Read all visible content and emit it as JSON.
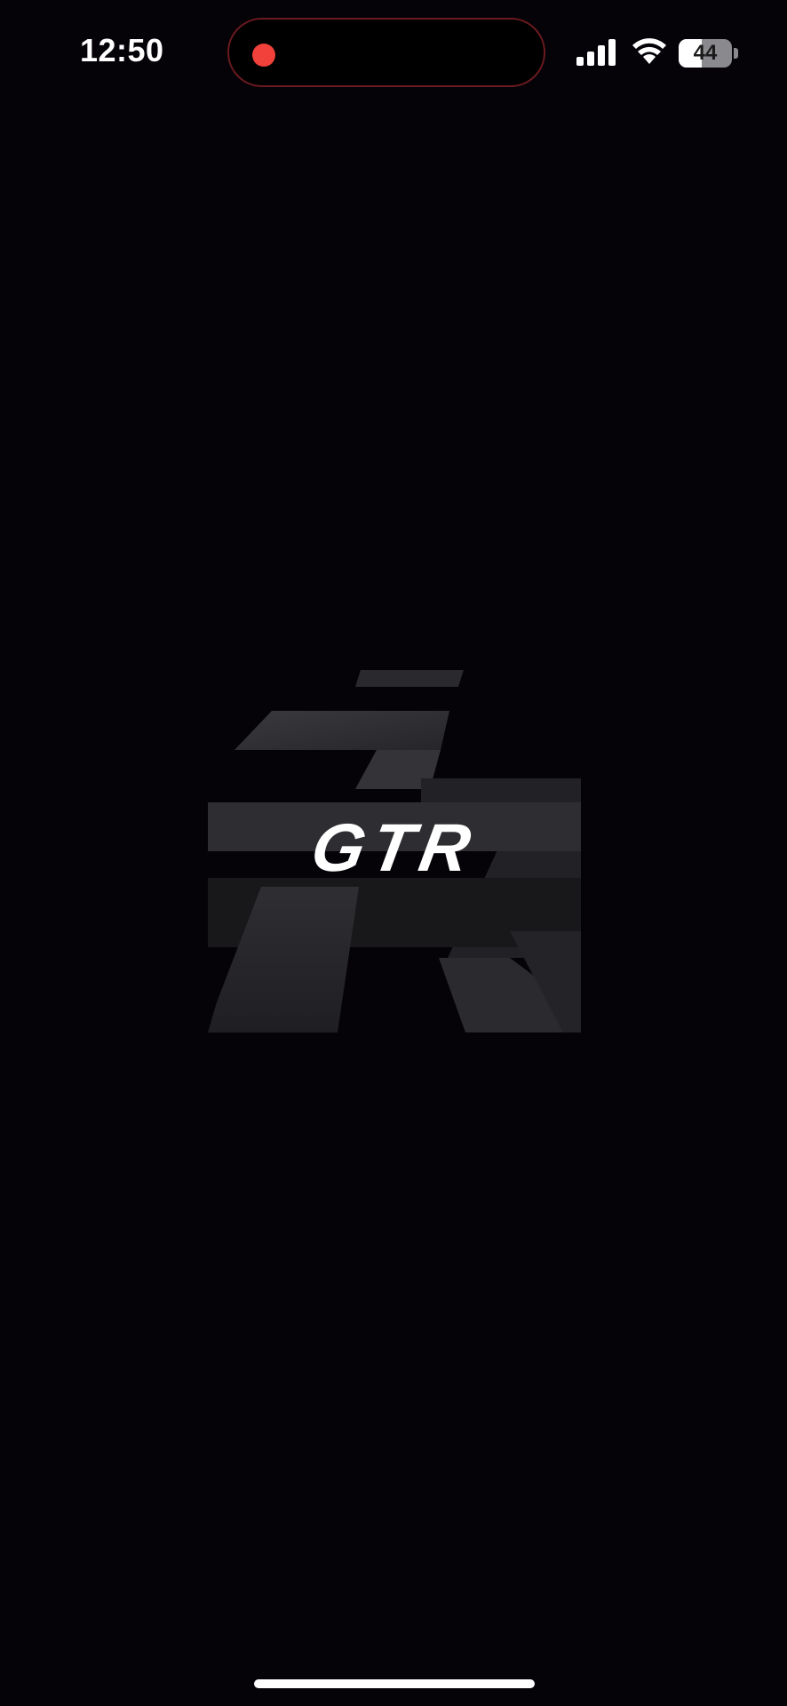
{
  "status_bar": {
    "time": "12:50",
    "battery_level": "44",
    "battery_fraction": 0.44,
    "recording_indicator_color": "#f2413b",
    "icons": [
      "cellular-signal-icon",
      "wifi-icon",
      "battery-icon"
    ]
  },
  "splash": {
    "brand_name": "GTR",
    "background_color": "#050308",
    "logo_mark": "stylized-gtr-emblem"
  }
}
